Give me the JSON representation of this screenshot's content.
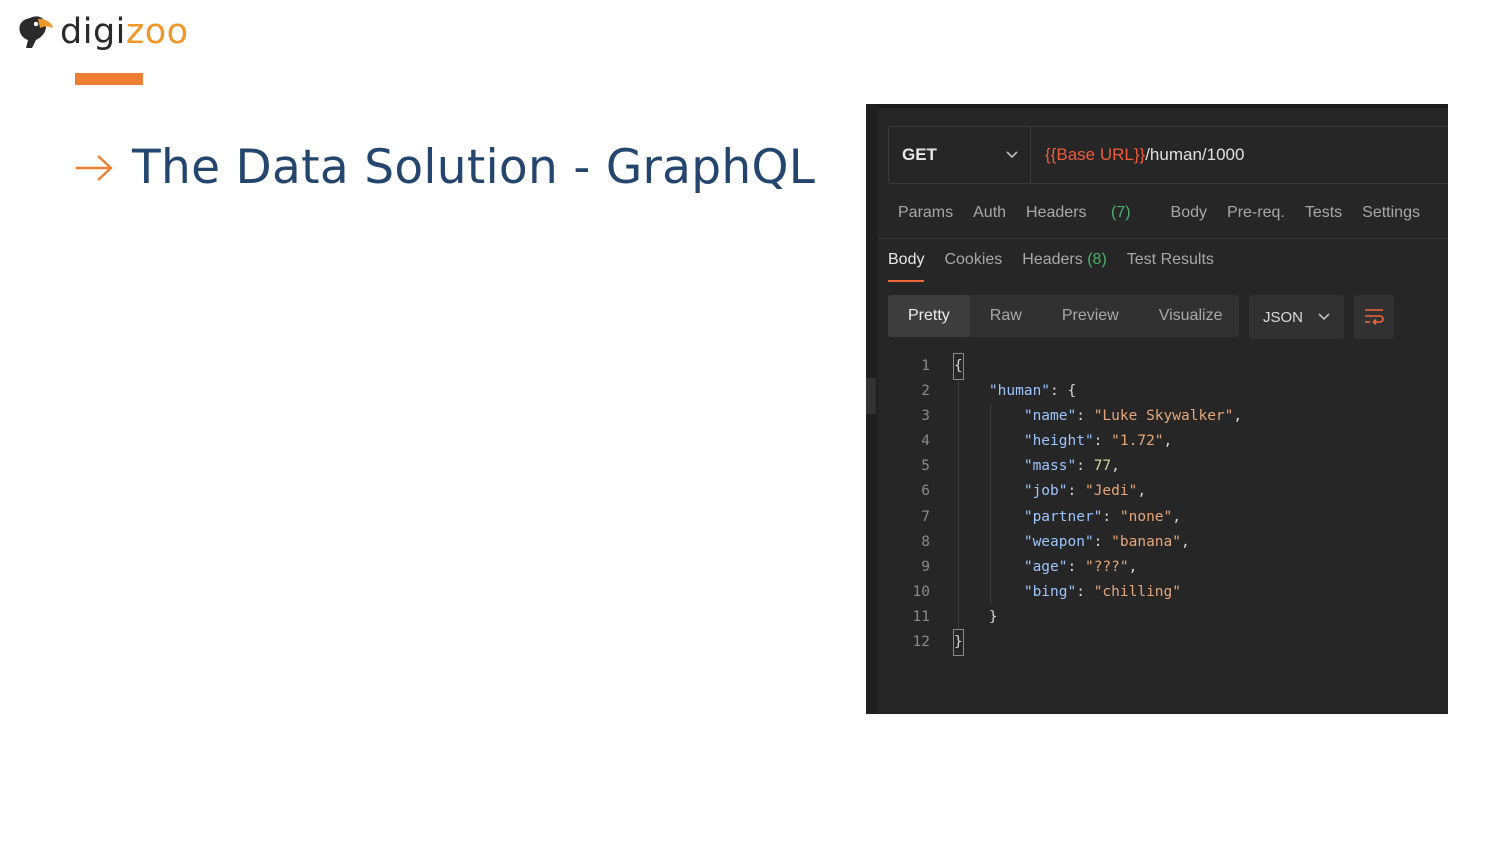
{
  "logo": {
    "part1": "digi",
    "part2": "zoo",
    "icon": "toucan-bird-icon",
    "color_dark": "#2a2a2a",
    "color_accent": "#f0972b"
  },
  "slide": {
    "title": "The Data Solution - GraphQL",
    "title_color": "#24466e",
    "accent_color": "#ee7e32"
  },
  "request": {
    "method": "GET",
    "url_variable": "{{Base URL}}",
    "url_path": "/human/1000"
  },
  "request_tabs": {
    "params": "Params",
    "auth": "Auth",
    "headers": "Headers",
    "headers_count": "(7)",
    "body": "Body",
    "prereq": "Pre-req.",
    "tests": "Tests",
    "settings": "Settings"
  },
  "response_tabs": {
    "body": "Body",
    "cookies": "Cookies",
    "headers": "Headers",
    "headers_count": "(8)",
    "test_results": "Test Results"
  },
  "view_modes": {
    "pretty": "Pretty",
    "raw": "Raw",
    "preview": "Preview",
    "visualize": "Visualize"
  },
  "format": {
    "selected": "JSON"
  },
  "code": {
    "lines": [
      {
        "n": "1",
        "open_brace": "{"
      },
      {
        "n": "2",
        "key": "\"human\"",
        "rest": ": {"
      },
      {
        "n": "3",
        "key": "\"name\"",
        "value": "\"Luke Skywalker\"",
        "trail": ","
      },
      {
        "n": "4",
        "key": "\"height\"",
        "value": "\"1.72\"",
        "trail": ","
      },
      {
        "n": "5",
        "key": "\"mass\"",
        "num": "77",
        "trail": ","
      },
      {
        "n": "6",
        "key": "\"job\"",
        "value": "\"Jedi\"",
        "trail": ","
      },
      {
        "n": "7",
        "key": "\"partner\"",
        "value": "\"none\"",
        "trail": ","
      },
      {
        "n": "8",
        "key": "\"weapon\"",
        "value": "\"banana\"",
        "trail": ","
      },
      {
        "n": "9",
        "key": "\"age\"",
        "value": "\"???\"",
        "trail": ","
      },
      {
        "n": "10",
        "key": "\"bing\"",
        "value": "\"chilling\"",
        "trail": ""
      },
      {
        "n": "11",
        "close": "}"
      },
      {
        "n": "12",
        "close_brace": "}"
      }
    ]
  }
}
